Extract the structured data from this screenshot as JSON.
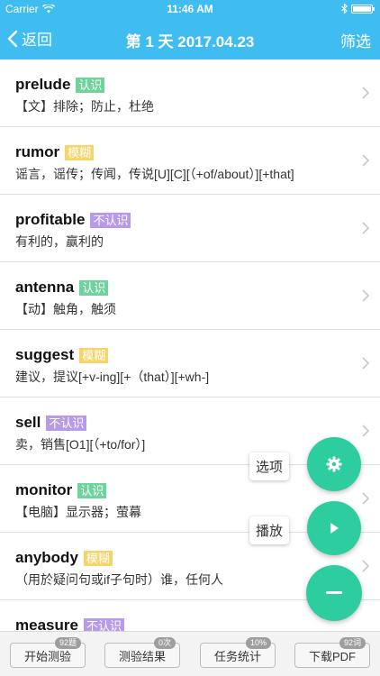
{
  "status": {
    "carrier": "Carrier",
    "time": "11:46 AM"
  },
  "nav": {
    "back_label": "返回",
    "title": "第 1 天 2017.04.23",
    "filter_label": "筛选"
  },
  "words": [
    {
      "word": "prelude",
      "tag": "认识",
      "status": "known",
      "definition": "【文】排除；防止，杜绝"
    },
    {
      "word": "rumor",
      "tag": "模糊",
      "status": "fuzzy",
      "definition": "谣言，谣传；传闻，传说[U][C][（+of/about）][+that]"
    },
    {
      "word": "profitable",
      "tag": "不认识",
      "status": "unknown",
      "definition": "有利的，赢利的"
    },
    {
      "word": "antenna",
      "tag": "认识",
      "status": "known",
      "definition": "【动】触角，触须"
    },
    {
      "word": "suggest",
      "tag": "模糊",
      "status": "fuzzy",
      "definition": "建议，提议[+v-ing][+（that）][+wh-]"
    },
    {
      "word": "sell",
      "tag": "不认识",
      "status": "unknown",
      "definition": "卖，销售[O1][（+to/for）]"
    },
    {
      "word": "monitor",
      "tag": "认识",
      "status": "known",
      "definition": "【电脑】显示器；萤幕"
    },
    {
      "word": "anybody",
      "tag": "模糊",
      "status": "fuzzy",
      "definition": "（用於疑问句或if子句时）谁，任何人"
    },
    {
      "word": "measure",
      "tag": "不认识",
      "status": "unknown",
      "definition": ""
    }
  ],
  "fabs": {
    "options_label": "选项",
    "play_label": "播放"
  },
  "bottom": [
    {
      "label": "开始测验",
      "badge": "92题"
    },
    {
      "label": "测验结果",
      "badge": "0次"
    },
    {
      "label": "任务统计",
      "badge": "10%"
    },
    {
      "label": "下载PDF",
      "badge": "92词"
    }
  ],
  "colors": {
    "primary": "#3fbdf0",
    "fab": "#2ecda0",
    "known": "#6fd39c",
    "fuzzy": "#f7d46a",
    "unknown": "#b79bea"
  }
}
